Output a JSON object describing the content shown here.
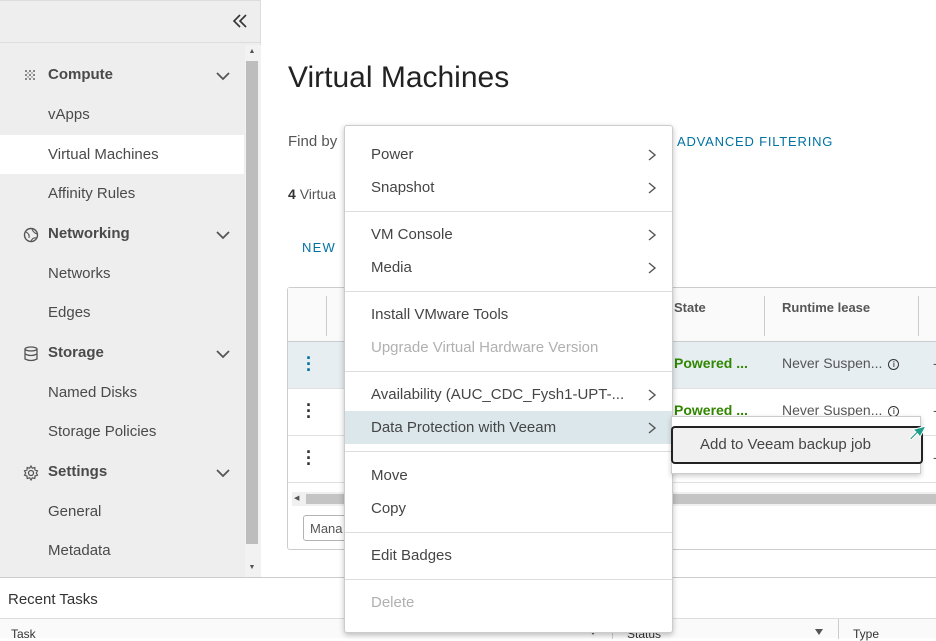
{
  "sidebar": {
    "groups": [
      {
        "label": "Compute",
        "icon": "compute-grid-icon",
        "items": [
          "vApps",
          "Virtual Machines",
          "Affinity Rules"
        ]
      },
      {
        "label": "Networking",
        "icon": "network-globe-icon",
        "items": [
          "Networks",
          "Edges"
        ]
      },
      {
        "label": "Storage",
        "icon": "storage-database-icon",
        "items": [
          "Named Disks",
          "Storage Policies"
        ]
      },
      {
        "label": "Settings",
        "icon": "gear-icon",
        "items": [
          "General",
          "Metadata"
        ]
      }
    ],
    "active_item": "Virtual Machines"
  },
  "main": {
    "title": "Virtual Machines",
    "find_by_label": "Find by",
    "advanced_filtering_label": "ADVANCED FILTERING",
    "vm_count": "4",
    "vm_count_suffix": "Virtua",
    "new_button_label": "NEW",
    "grid": {
      "columns": [
        "State",
        "Runtime lease"
      ],
      "rows": [
        {
          "state": "Powered ...",
          "lease": "Never Suspen..."
        },
        {
          "state": "Powered ...",
          "lease": "Never Suspen..."
        },
        {
          "state": "",
          "lease": ""
        }
      ],
      "dash": "-",
      "manage_button_label": "Mana"
    }
  },
  "context_menu": {
    "items": [
      {
        "label": "Power",
        "submenu": true,
        "disabled": false
      },
      {
        "label": "Snapshot",
        "submenu": true,
        "disabled": false
      },
      {
        "label": "VM Console",
        "submenu": true,
        "disabled": false
      },
      {
        "label": "Media",
        "submenu": true,
        "disabled": false
      },
      {
        "label": "Install VMware Tools",
        "submenu": false,
        "disabled": false
      },
      {
        "label": "Upgrade Virtual Hardware Version",
        "submenu": false,
        "disabled": true
      },
      {
        "label": "Availability (AUC_CDC_Fysh1-UPT-...",
        "submenu": true,
        "disabled": false
      },
      {
        "label": "Data Protection with Veeam",
        "submenu": true,
        "disabled": false,
        "highlighted": true
      },
      {
        "label": "Move",
        "submenu": false,
        "disabled": false
      },
      {
        "label": "Copy",
        "submenu": false,
        "disabled": false
      },
      {
        "label": "Edit Badges",
        "submenu": false,
        "disabled": false
      },
      {
        "label": "Delete",
        "submenu": false,
        "disabled": true
      }
    ],
    "submenu_item": "Add to Veeam backup job"
  },
  "recent_tasks": {
    "title": "Recent Tasks",
    "columns": [
      "Task",
      "Status",
      "Type"
    ]
  },
  "colors": {
    "accent": "#0072a3",
    "success": "#318700",
    "sidebar_bg": "#eeeeee",
    "highlight": "#dce7ec"
  }
}
